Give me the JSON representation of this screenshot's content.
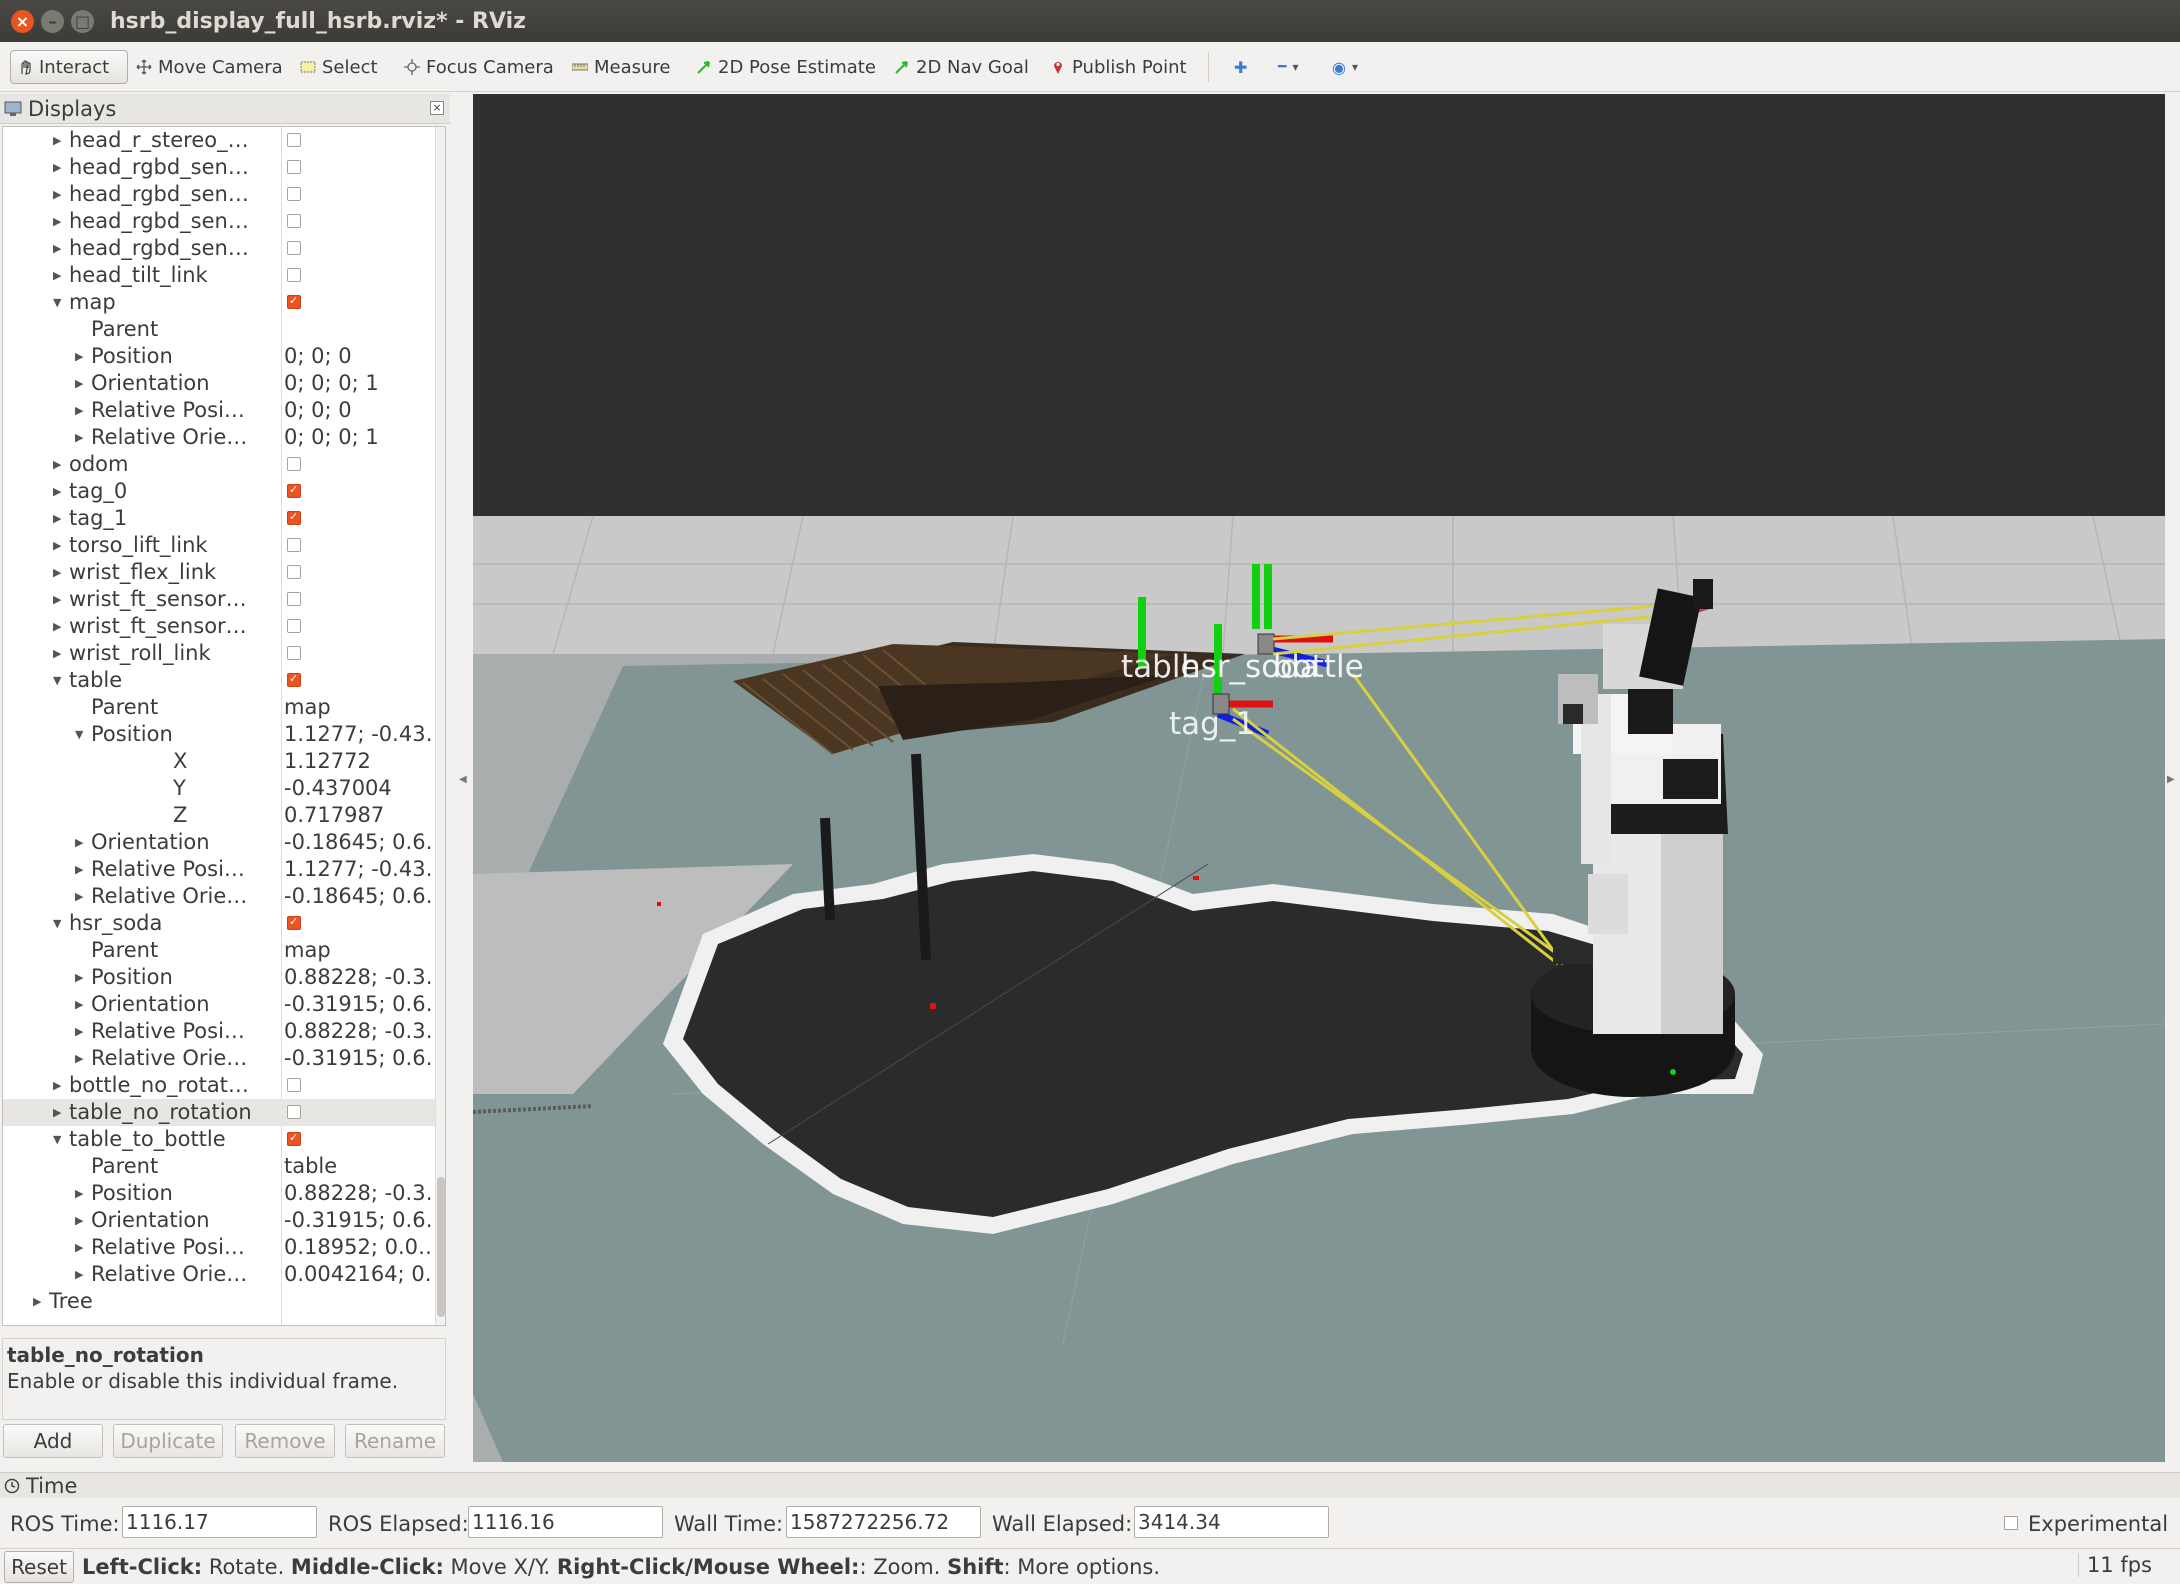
{
  "window": {
    "title": "hsrb_display_full_hsrb.rviz* - RViz",
    "close_glyph": "×",
    "min_glyph": "–",
    "max_glyph": "□"
  },
  "toolbar": {
    "tools": [
      {
        "label": "Interact",
        "icon": "hand-icon",
        "active": true
      },
      {
        "label": "Move Camera",
        "icon": "move-camera-icon"
      },
      {
        "label": "Select",
        "icon": "select-icon"
      },
      {
        "label": "Focus Camera",
        "icon": "focus-camera-icon"
      },
      {
        "label": "Measure",
        "icon": "measure-icon"
      },
      {
        "label": "2D Pose Estimate",
        "icon": "pose-estimate-icon"
      },
      {
        "label": "2D Nav Goal",
        "icon": "nav-goal-icon"
      },
      {
        "label": "Publish Point",
        "icon": "publish-point-icon"
      }
    ],
    "extra_icons": [
      "plus-icon",
      "minus-icon",
      "eye-icon"
    ],
    "extra_glyphs": [
      "✚",
      "━",
      "◉"
    ],
    "dropdown_glyph": "▾",
    "accent_green": "#1fbf1f",
    "accent_red": "#c0392b"
  },
  "displays": {
    "title": "Displays",
    "close_glyph": "×",
    "expanded_glyph": "▼",
    "collapsed_glyph": "▶",
    "rows": [
      {
        "label": "head_r_stereo_…",
        "indent": 1,
        "arrow": "collapsed",
        "checkbox": false
      },
      {
        "label": "head_rgbd_sen…",
        "indent": 1,
        "arrow": "collapsed",
        "checkbox": false
      },
      {
        "label": "head_rgbd_sen…",
        "indent": 1,
        "arrow": "collapsed",
        "checkbox": false
      },
      {
        "label": "head_rgbd_sen…",
        "indent": 1,
        "arrow": "collapsed",
        "checkbox": false
      },
      {
        "label": "head_rgbd_sen…",
        "indent": 1,
        "arrow": "collapsed",
        "checkbox": false
      },
      {
        "label": "head_tilt_link",
        "indent": 1,
        "arrow": "collapsed",
        "checkbox": false
      },
      {
        "label": "map",
        "indent": 1,
        "arrow": "expanded",
        "checkbox": true
      },
      {
        "label": "Parent",
        "indent": 2,
        "arrow": "none",
        "value": ""
      },
      {
        "label": "Position",
        "indent": 2,
        "arrow": "collapsed",
        "value": "0; 0; 0"
      },
      {
        "label": "Orientation",
        "indent": 2,
        "arrow": "collapsed",
        "value": "0; 0; 0; 1"
      },
      {
        "label": "Relative Posi…",
        "indent": 2,
        "arrow": "collapsed",
        "value": "0; 0; 0"
      },
      {
        "label": "Relative Orie…",
        "indent": 2,
        "arrow": "collapsed",
        "value": "0; 0; 0; 1"
      },
      {
        "label": "odom",
        "indent": 1,
        "arrow": "collapsed",
        "checkbox": false
      },
      {
        "label": "tag_0",
        "indent": 1,
        "arrow": "collapsed",
        "checkbox": true
      },
      {
        "label": "tag_1",
        "indent": 1,
        "arrow": "collapsed",
        "checkbox": true
      },
      {
        "label": "torso_lift_link",
        "indent": 1,
        "arrow": "collapsed",
        "checkbox": false
      },
      {
        "label": "wrist_flex_link",
        "indent": 1,
        "arrow": "collapsed",
        "checkbox": false
      },
      {
        "label": "wrist_ft_sensor…",
        "indent": 1,
        "arrow": "collapsed",
        "checkbox": false
      },
      {
        "label": "wrist_ft_sensor…",
        "indent": 1,
        "arrow": "collapsed",
        "checkbox": false
      },
      {
        "label": "wrist_roll_link",
        "indent": 1,
        "arrow": "collapsed",
        "checkbox": false
      },
      {
        "label": "table",
        "indent": 1,
        "arrow": "expanded",
        "checkbox": true
      },
      {
        "label": "Parent",
        "indent": 2,
        "arrow": "none",
        "value": "map"
      },
      {
        "label": "Position",
        "indent": 2,
        "arrow": "expanded",
        "value": "1.1277; -0.43…"
      },
      {
        "label": "X",
        "indent": 3,
        "arrow": "none",
        "value": "1.12772"
      },
      {
        "label": "Y",
        "indent": 3,
        "arrow": "none",
        "value": "-0.437004"
      },
      {
        "label": "Z",
        "indent": 3,
        "arrow": "none",
        "value": "0.717987"
      },
      {
        "label": "Orientation",
        "indent": 2,
        "arrow": "collapsed",
        "value": "-0.18645; 0.6…"
      },
      {
        "label": "Relative Posi…",
        "indent": 2,
        "arrow": "collapsed",
        "value": "1.1277; -0.43…"
      },
      {
        "label": "Relative Orie…",
        "indent": 2,
        "arrow": "collapsed",
        "value": "-0.18645; 0.6…"
      },
      {
        "label": "hsr_soda",
        "indent": 1,
        "arrow": "expanded",
        "checkbox": true
      },
      {
        "label": "Parent",
        "indent": 2,
        "arrow": "none",
        "value": "map"
      },
      {
        "label": "Position",
        "indent": 2,
        "arrow": "collapsed",
        "value": "0.88228; -0.3…"
      },
      {
        "label": "Orientation",
        "indent": 2,
        "arrow": "collapsed",
        "value": "-0.31915; 0.6…"
      },
      {
        "label": "Relative Posi…",
        "indent": 2,
        "arrow": "collapsed",
        "value": "0.88228; -0.3…"
      },
      {
        "label": "Relative Orie…",
        "indent": 2,
        "arrow": "collapsed",
        "value": "-0.31915; 0.6…"
      },
      {
        "label": "bottle_no_rotat…",
        "indent": 1,
        "arrow": "collapsed",
        "checkbox": false
      },
      {
        "label": "table_no_rotation",
        "indent": 1,
        "arrow": "collapsed",
        "checkbox": false,
        "selected": true
      },
      {
        "label": "table_to_bottle",
        "indent": 1,
        "arrow": "expanded",
        "checkbox": true
      },
      {
        "label": "Parent",
        "indent": 2,
        "arrow": "none",
        "value": "table"
      },
      {
        "label": "Position",
        "indent": 2,
        "arrow": "collapsed",
        "value": "0.88228; -0.3…"
      },
      {
        "label": "Orientation",
        "indent": 2,
        "arrow": "collapsed",
        "value": "-0.31915; 0.6…"
      },
      {
        "label": "Relative Posi…",
        "indent": 2,
        "arrow": "collapsed",
        "value": "0.18952; 0.0…"
      },
      {
        "label": "Relative Orie…",
        "indent": 2,
        "arrow": "collapsed",
        "value": "0.0042164; 0…"
      },
      {
        "label": "Tree",
        "indent": 0,
        "arrow": "collapsed"
      }
    ],
    "description": {
      "title": "table_no_rotation",
      "text": "Enable or disable this individual frame."
    },
    "buttons": {
      "add": "Add",
      "duplicate": "Duplicate",
      "remove": "Remove",
      "rename": "Rename"
    }
  },
  "viewport": {
    "tf_labels": [
      "table",
      "hsr_soda",
      "bottle",
      "tag_1"
    ],
    "colors": {
      "background": "#303030",
      "floor": "#819594",
      "costmap": "#2b2b2b",
      "axis_x": "#e01010",
      "axis_y": "#10d010",
      "axis_z": "#1020e0",
      "tf_line": "#d8d040",
      "goal": "#e0207a"
    }
  },
  "time": {
    "title": "Time",
    "ros_time_label": "ROS Time:",
    "ros_time": "1116.17",
    "ros_elapsed_label": "ROS Elapsed:",
    "ros_elapsed": "1116.16",
    "wall_time_label": "Wall Time:",
    "wall_time": "1587272256.72",
    "wall_elapsed_label": "Wall Elapsed:",
    "wall_elapsed": "3414.34",
    "experimental_label": "Experimental"
  },
  "status": {
    "reset": "Reset",
    "hint_parts": [
      {
        "b": "Left-Click:",
        "t": " Rotate. "
      },
      {
        "b": "Middle-Click:",
        "t": " Move X/Y. "
      },
      {
        "b": "Right-Click/Mouse Wheel:",
        "t": ": Zoom. "
      },
      {
        "b": "Shift",
        "t": ": More options."
      }
    ],
    "fps": "11 fps"
  }
}
